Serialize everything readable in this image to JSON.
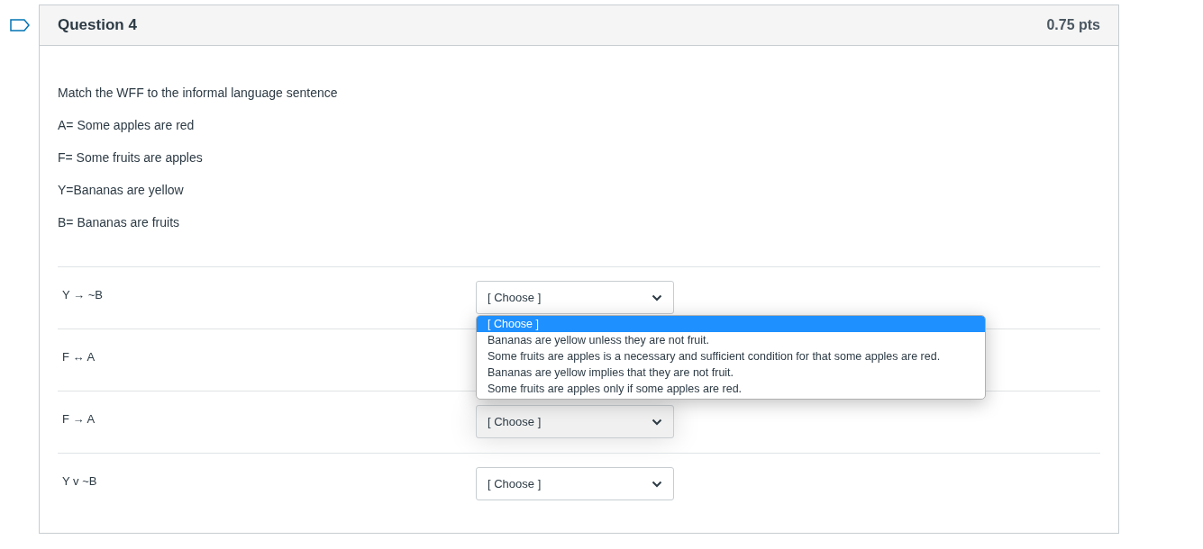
{
  "question": {
    "title": "Question 4",
    "points": "0.75 pts",
    "flagged": false
  },
  "prompt": [
    "Match the WFF  to the informal language sentence",
    "A= Some apples are red",
    "F= Some fruits are apples",
    "Y=Bananas are yellow",
    "B= Bananas are fruits"
  ],
  "rows": [
    {
      "wff": "Y → ~B",
      "select": {
        "value": "[ Choose ]",
        "highlighted": false,
        "open": true
      }
    },
    {
      "wff": "F ↔ A"
    },
    {
      "wff": "F → A",
      "select": {
        "value": "[ Choose ]",
        "highlighted": true,
        "open": false
      }
    },
    {
      "wff": "Y v ~B",
      "select": {
        "value": "[ Choose ]",
        "highlighted": false,
        "open": false
      }
    }
  ],
  "dropdown_options": [
    {
      "label": "[ Choose ]",
      "selected": true
    },
    {
      "label": "Bananas are yellow unless they are not fruit.",
      "selected": false
    },
    {
      "label": "Some fruits are apples is a necessary and sufficient condition for that some apples are red.",
      "selected": false
    },
    {
      "label": "Bananas are yellow implies that they are not fruit.",
      "selected": false
    },
    {
      "label": "Some fruits are apples only if some apples are red.",
      "selected": false
    }
  ]
}
